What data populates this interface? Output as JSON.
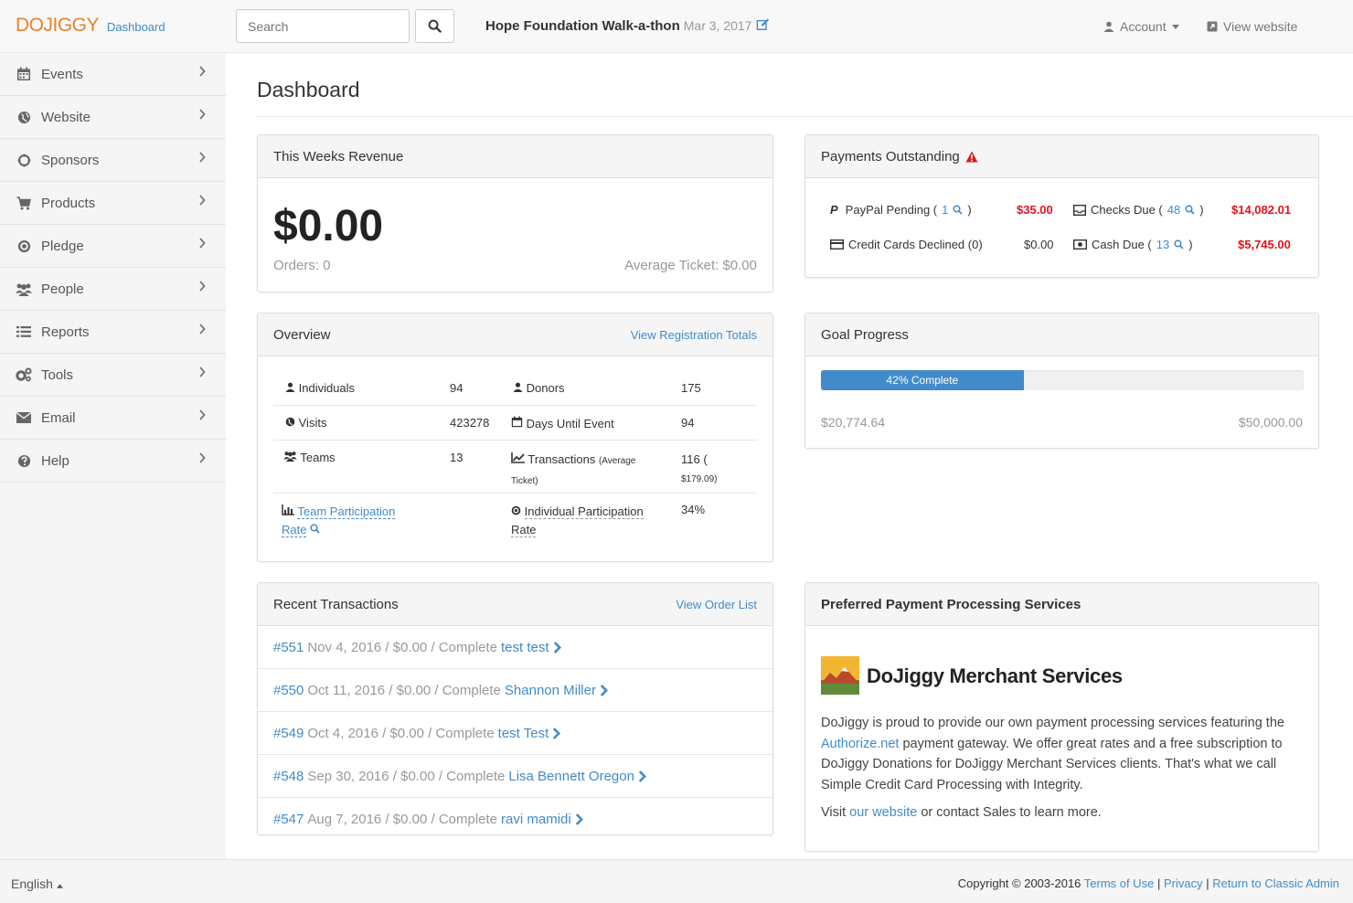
{
  "header": {
    "brand": "DOJIGGY",
    "brand_sub": "Dashboard",
    "search_placeholder": "Search",
    "event_title": "Hope Foundation Walk-a-thon",
    "event_date": "Mar 3, 2017",
    "account_label": "Account",
    "view_website_label": "View website"
  },
  "sidebar": {
    "items": [
      {
        "label": "Events",
        "icon": "calendar-icon"
      },
      {
        "label": "Website",
        "icon": "globe-icon"
      },
      {
        "label": "Sponsors",
        "icon": "circle-notch-icon"
      },
      {
        "label": "Products",
        "icon": "cart-icon"
      },
      {
        "label": "Pledge",
        "icon": "bullseye-icon"
      },
      {
        "label": "People",
        "icon": "users-icon"
      },
      {
        "label": "Reports",
        "icon": "list-icon"
      },
      {
        "label": "Tools",
        "icon": "cogs-icon"
      },
      {
        "label": "Email",
        "icon": "envelope-icon"
      },
      {
        "label": "Help",
        "icon": "question-icon"
      }
    ]
  },
  "page_title": "Dashboard",
  "revenue": {
    "title": "This Weeks Revenue",
    "amount": "$0.00",
    "orders": "Orders: 0",
    "average": "Average Ticket: $0.00"
  },
  "payments": {
    "title": "Payments Outstanding",
    "paypal_label": "PayPal Pending (",
    "paypal_count": "1",
    "paypal_close": ")",
    "paypal_amount": "$35.00",
    "checks_label": "Checks Due (",
    "checks_count": "48",
    "checks_close": ")",
    "checks_amount": "$14,082.01",
    "cards_label": "Credit Cards Declined (0)",
    "cards_amount": "$0.00",
    "cash_label": "Cash Due (",
    "cash_count": "13",
    "cash_close": ")",
    "cash_amount": "$5,745.00"
  },
  "overview": {
    "title": "Overview",
    "link": "View Registration Totals",
    "individuals_label": "Individuals",
    "individuals_value": "94",
    "donors_label": "Donors",
    "donors_value": "175",
    "visits_label": "Visits",
    "visits_value": "423278",
    "days_label": "Days Until Event",
    "days_value": "94",
    "teams_label": "Teams",
    "teams_value": "13",
    "transactions_label": "Transactions",
    "transactions_sub1": "(Average",
    "transactions_sub2": "Ticket)",
    "transactions_value": "116 (",
    "transactions_value2": "$179.09)",
    "team_rate_1": "Team Participation",
    "team_rate_2": "Rate",
    "indiv_rate_1": "Individual Participation",
    "indiv_rate_2": "Rate",
    "indiv_rate_value": "34%"
  },
  "goal": {
    "title": "Goal Progress",
    "percent": 0.42,
    "bar_label": "42% Complete",
    "raised": "$20,774.64",
    "target": "$50,000.00"
  },
  "transactions": {
    "title": "Recent Transactions",
    "link": "View Order List",
    "rows": [
      {
        "id": "#551",
        "details": "Nov 4, 2016 / $0.00 / Complete",
        "name": "test test"
      },
      {
        "id": "#550",
        "details": "Oct 11, 2016 / $0.00 / Complete",
        "name": "Shannon Miller"
      },
      {
        "id": "#549",
        "details": "Oct 4, 2016 / $0.00 / Complete",
        "name": "test Test"
      },
      {
        "id": "#548",
        "details": "Sep 30, 2016 / $0.00 / Complete",
        "name": "Lisa Bennett Oregon"
      },
      {
        "id": "#547",
        "details": "Aug 7, 2016 / $0.00 / Complete",
        "name": "ravi mamidi"
      }
    ]
  },
  "merchant": {
    "title": "Preferred Payment Processing Services",
    "name": "DoJiggy Merchant Services",
    "p1_a": "DoJiggy is proud to provide our own payment processing services featuring the ",
    "p1_link": "Authorize.net",
    "p1_b": " payment gateway. We offer great rates and a free subscription to DoJiggy Donations for DoJiggy Merchant Services clients. That's what we call Simple Credit Card Processing with Integrity.",
    "p2_a": "Visit ",
    "p2_link": "our website",
    "p2_b": " or contact Sales to learn more."
  },
  "footer": {
    "language": "English",
    "copyright": "Copyright © 2003-2016",
    "terms": "Terms of Use",
    "sep": "|",
    "privacy": "Privacy",
    "classic": "Return to Classic Admin"
  },
  "colors": {
    "accent": "#428bca",
    "brand": "#e8822b",
    "alert": "#e2141b"
  }
}
